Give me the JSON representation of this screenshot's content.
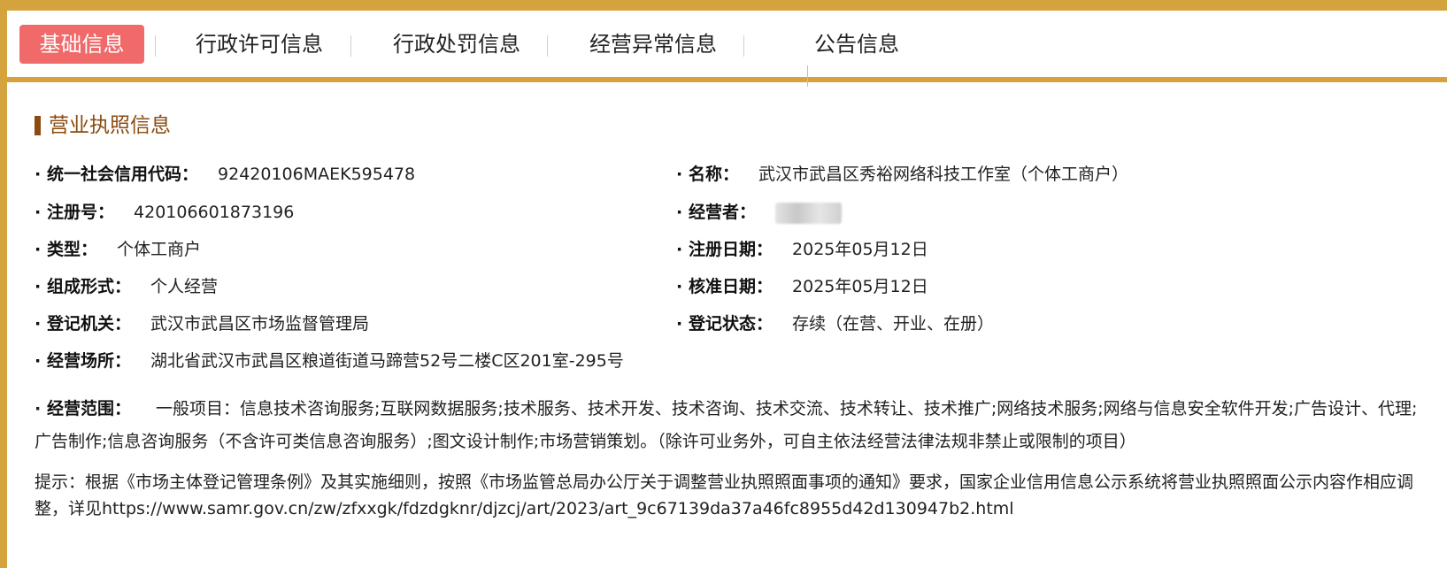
{
  "tabs": [
    {
      "label": "基础信息",
      "active": true
    },
    {
      "label": "行政许可信息",
      "active": false
    },
    {
      "label": "行政处罚信息",
      "active": false
    },
    {
      "label": "经营异常信息",
      "active": false
    },
    {
      "label": "公告信息",
      "active": false
    }
  ],
  "section": {
    "title": "营业执照信息"
  },
  "fields": {
    "credit_code": {
      "label": "统一社会信用代码：",
      "value": "92420106MAEK595478"
    },
    "name": {
      "label": "名称：",
      "value": "武汉市武昌区秀裕网络科技工作室（个体工商户）"
    },
    "reg_no": {
      "label": "注册号：",
      "value": "420106601873196"
    },
    "operator": {
      "label": "经营者：",
      "value": ""
    },
    "type": {
      "label": "类型：",
      "value": "个体工商户"
    },
    "reg_date": {
      "label": "注册日期：",
      "value": "2025年05月12日"
    },
    "form": {
      "label": "组成形式：",
      "value": "个人经营"
    },
    "approve_date": {
      "label": "核准日期：",
      "value": "2025年05月12日"
    },
    "authority": {
      "label": "登记机关：",
      "value": "武汉市武昌区市场监督管理局"
    },
    "status": {
      "label": "登记状态：",
      "value": "存续（在营、开业、在册）"
    },
    "address": {
      "label": "经营场所：",
      "value": "湖北省武汉市武昌区粮道街道马蹄营52号二楼C区201室-295号"
    },
    "scope": {
      "label": "经营范围：",
      "value": "一般项目：信息技术咨询服务;互联网数据服务;技术服务、技术开发、技术咨询、技术交流、技术转让、技术推广;网络技术服务;网络与信息安全软件开发;广告设计、代理;广告制作;信息咨询服务（不含许可类信息咨询服务）;图文设计制作;市场营销策划。（除许可业务外，可自主依法经营法律法规非禁止或限制的项目）"
    }
  },
  "bullet": "·",
  "hint": "提示：根据《市场主体登记管理条例》及其实施细则，按照《市场监管总局办公厅关于调整营业执照照面事项的通知》要求，国家企业信用信息公示系统将营业执照照面公示内容作相应调整，详见https://www.samr.gov.cn/zw/zfxxgk/fdzdgknr/djzcj/art/2023/art_9c67139da37a46fc8955d42d130947b2.html",
  "colors": {
    "frame": "#d4a33d",
    "active_tab": "#f16a6a",
    "section_title": "#8a4b10"
  }
}
